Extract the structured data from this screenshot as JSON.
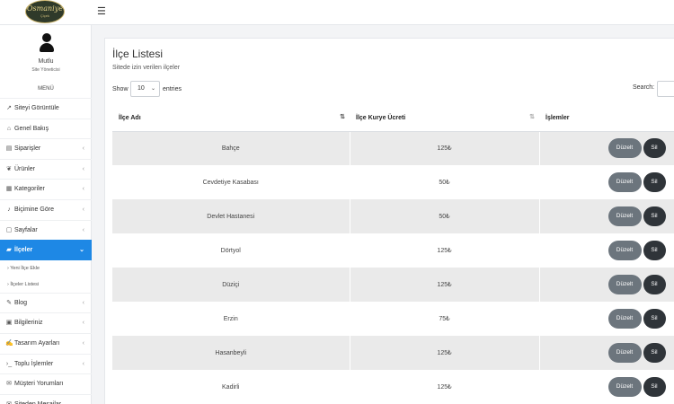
{
  "header": {
    "logo_text": "Osmaniye",
    "logo_subtext": "Çiçek",
    "menu_icon": "hamburger-icon"
  },
  "sidebar": {
    "user_name": "Mutlu",
    "user_role": "Site Yöneticisi",
    "menu_heading": "MENÜ",
    "items": [
      {
        "label": "Siteyi Görüntüle",
        "icon": "external-link-icon",
        "chevron": false
      },
      {
        "label": "Genel Bakış",
        "icon": "home-icon",
        "chevron": false
      },
      {
        "label": "Siparişler",
        "icon": "receipt-icon",
        "chevron": true
      },
      {
        "label": "Ürünler",
        "icon": "leaf-icon",
        "chevron": true
      },
      {
        "label": "Kategoriler",
        "icon": "grid-icon",
        "chevron": true
      },
      {
        "label": "Biçimine Göre",
        "icon": "bell-icon",
        "chevron": true
      },
      {
        "label": "Sayfalar",
        "icon": "file-icon",
        "chevron": true
      },
      {
        "label": "İlçeler",
        "icon": "map-icon",
        "chevron": true,
        "active": true
      },
      {
        "label": "Blog",
        "icon": "pencil-icon",
        "chevron": true
      },
      {
        "label": "Bilgileriniz",
        "icon": "id-card-icon",
        "chevron": true
      },
      {
        "label": "Tasarım Ayarları",
        "icon": "edit-icon",
        "chevron": true
      },
      {
        "label": "Toplu İşlemler",
        "icon": "terminal-icon",
        "chevron": true
      },
      {
        "label": "Müşteri Yorumları",
        "icon": "comments-icon",
        "chevron": false
      },
      {
        "label": "Siteden Mesajlar",
        "icon": "envelope-icon",
        "chevron": false
      }
    ],
    "sub_items": [
      {
        "label": "› Yeni İlçe Ekle"
      },
      {
        "label": "› İlçeler Listesi"
      }
    ],
    "active_color": "#1e88e5"
  },
  "main": {
    "title": "İlçe Listesi",
    "subtitle": "Sitede izin verilen ilçeler",
    "show_label": "Show",
    "show_value": "10",
    "entries_label": "entries",
    "search_label": "Search:",
    "search_value": "",
    "columns": [
      "İlçe Adı",
      "İlçe Kurye Ücreti",
      "İşlemler"
    ],
    "edit_label": "Düzelt",
    "delete_label": "Sil",
    "rows": [
      {
        "name": "Bahçe",
        "fee": "125₺"
      },
      {
        "name": "Cevdetiye Kasabası",
        "fee": "50₺"
      },
      {
        "name": "Devlet Hastanesi",
        "fee": "50₺"
      },
      {
        "name": "Dörtyol",
        "fee": "125₺"
      },
      {
        "name": "Düziçi",
        "fee": "125₺"
      },
      {
        "name": "Erzin",
        "fee": "75₺"
      },
      {
        "name": "Hasanbeyli",
        "fee": "125₺"
      },
      {
        "name": "Kadirli",
        "fee": "125₺"
      }
    ]
  }
}
